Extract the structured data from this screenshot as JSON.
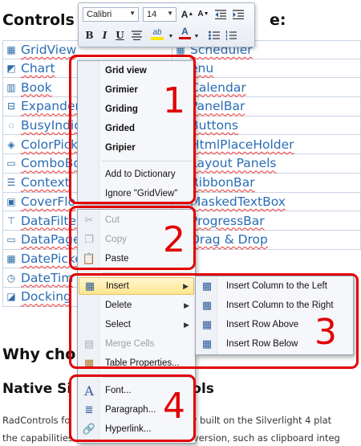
{
  "heading_controls_left": "Controls i",
  "heading_controls_right": "e:",
  "controls_left": [
    {
      "label": "GridView",
      "icon": "grid-icon"
    },
    {
      "label": "Chart",
      "icon": "chart-icon"
    },
    {
      "label": "Book",
      "icon": "book-icon"
    },
    {
      "label": "Expander",
      "icon": "expander-icon"
    },
    {
      "label": "BusyIndic",
      "icon": "busy-indicator-icon"
    },
    {
      "label": "ColorPick",
      "icon": "color-picker-icon"
    },
    {
      "label": "ComboBo",
      "icon": "combobox-icon"
    },
    {
      "label": "Context",
      "icon": "context-menu-icon"
    },
    {
      "label": "CoverFlo",
      "icon": "coverflow-icon"
    },
    {
      "label": "DataFilter",
      "icon": "datafilter-icon"
    },
    {
      "label": "DataPage",
      "icon": "datapager-icon"
    },
    {
      "label": "DatePicke",
      "icon": "datepicker-icon"
    },
    {
      "label": "DateTim",
      "icon": "datetime-icon"
    },
    {
      "label": "Docking",
      "icon": "docking-icon"
    }
  ],
  "controls_right": [
    {
      "label": "Scheduler",
      "icon": "scheduler-icon"
    },
    {
      "label": "enu",
      "icon": ""
    },
    {
      "label": "Calendar",
      "icon": ""
    },
    {
      "label": "PanelBar",
      "icon": ""
    },
    {
      "label": "Buttons",
      "icon": ""
    },
    {
      "label": "HtmlPlaceHolder",
      "icon": ""
    },
    {
      "label": "Layout Panels",
      "icon": ""
    },
    {
      "label": "RibbonBar",
      "icon": ""
    },
    {
      "label": "MaskedTextBox",
      "icon": ""
    },
    {
      "label": "ProgressBar",
      "icon": ""
    },
    {
      "label": "Drag & Drop",
      "icon": ""
    }
  ],
  "heading_why": "Why cho",
  "heading_native_left": "Native Si",
  "heading_native_right": "ols",
  "para_line1_left": "RadControls fo",
  "para_line1_right": "ly built on the Silverlight 4 plat",
  "para_line2_left": "the capabilities",
  "para_line2_right": "version, such as clipboard integ",
  "toolbar": {
    "font_name": "Calibri",
    "font_size": "14",
    "grow_font_label": "A",
    "shrink_font_label": "A",
    "bold_label": "B",
    "italic_label": "I",
    "underline_label": "U",
    "highlight_label": "ab",
    "font_color_label": "A",
    "colors": {
      "highlight": "#ffe600",
      "font_color": "#d40000"
    }
  },
  "spell_menu": {
    "suggestions": [
      "Grid view",
      "Grimier",
      "Griding",
      "Grided",
      "Gripier"
    ],
    "add_to_dictionary": "Add to Dictionary",
    "ignore": "Ignore \"GridView\""
  },
  "clipboard_menu": {
    "cut": "Cut",
    "copy": "Copy",
    "paste": "Paste"
  },
  "table_menu": {
    "insert": "Insert",
    "delete": "Delete",
    "select": "Select",
    "merge_cells": "Merge Cells",
    "table_properties": "Table Properties..."
  },
  "insert_submenu": [
    "Insert Column to the Left",
    "Insert Column to the Right",
    "Insert Row Above",
    "Insert Row Below"
  ],
  "format_menu": {
    "font": "Font...",
    "paragraph": "Paragraph...",
    "hyperlink": "Hyperlink..."
  },
  "annotation_numbers": [
    "1",
    "2",
    "3",
    "4"
  ],
  "annotation_color": "#e10000"
}
